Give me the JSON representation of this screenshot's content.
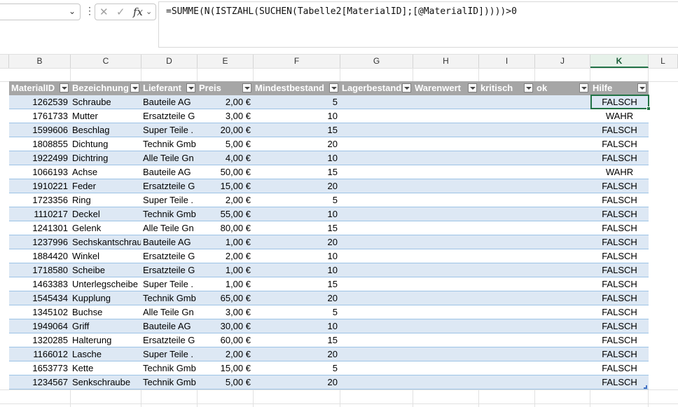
{
  "formula_bar": {
    "formula": "=SUMME(N(ISTZAHL(SUCHEN(Tabelle2[MaterialID];[@MaterialID]))))>0",
    "fx_label": "fx",
    "cancel_glyph": "✕",
    "enter_glyph": "✓"
  },
  "columns": [
    "B",
    "C",
    "D",
    "E",
    "F",
    "G",
    "H",
    "I",
    "J",
    "K",
    "L"
  ],
  "selected_column": "K",
  "table_headers": [
    "MaterialID",
    "Bezeichnung",
    "Lieferant",
    "Preis",
    "Mindestbestand",
    "Lagerbestand",
    "Warenwert",
    "kritisch",
    "ok",
    "Hilfe"
  ],
  "rows": [
    {
      "id": "1262539",
      "name": "Schraube",
      "supplier": "Bauteile AG",
      "price": "2,00 €",
      "min": "5",
      "help": "FALSCH"
    },
    {
      "id": "1761733",
      "name": "Mutter",
      "supplier": "Ersatzteile G",
      "price": "3,00 €",
      "min": "10",
      "help": "WAHR"
    },
    {
      "id": "1599606",
      "name": "Beschlag",
      "supplier": "Super Teile .",
      "price": "20,00 €",
      "min": "15",
      "help": "FALSCH"
    },
    {
      "id": "1808855",
      "name": "Dichtung",
      "supplier": "Technik Gmb",
      "price": "5,00 €",
      "min": "20",
      "help": "FALSCH"
    },
    {
      "id": "1922499",
      "name": "Dichtring",
      "supplier": "Alle Teile Gn",
      "price": "4,00 €",
      "min": "10",
      "help": "FALSCH"
    },
    {
      "id": "1066193",
      "name": "Achse",
      "supplier": "Bauteile AG",
      "price": "50,00 €",
      "min": "15",
      "help": "WAHR"
    },
    {
      "id": "1910221",
      "name": "Feder",
      "supplier": "Ersatzteile G",
      "price": "15,00 €",
      "min": "20",
      "help": "FALSCH"
    },
    {
      "id": "1723356",
      "name": "Ring",
      "supplier": "Super Teile .",
      "price": "2,00 €",
      "min": "5",
      "help": "FALSCH"
    },
    {
      "id": "1110217",
      "name": "Deckel",
      "supplier": "Technik Gmb",
      "price": "55,00 €",
      "min": "10",
      "help": "FALSCH"
    },
    {
      "id": "1241301",
      "name": "Gelenk",
      "supplier": "Alle Teile Gn",
      "price": "80,00 €",
      "min": "15",
      "help": "FALSCH"
    },
    {
      "id": "1237996",
      "name": "Sechskantschrau",
      "supplier": "Bauteile AG",
      "price": "1,00 €",
      "min": "20",
      "help": "FALSCH"
    },
    {
      "id": "1884420",
      "name": "Winkel",
      "supplier": "Ersatzteile G",
      "price": "2,00 €",
      "min": "10",
      "help": "FALSCH"
    },
    {
      "id": "1718580",
      "name": "Scheibe",
      "supplier": "Ersatzteile G",
      "price": "1,00 €",
      "min": "10",
      "help": "FALSCH"
    },
    {
      "id": "1463383",
      "name": "Unterlegscheibe",
      "supplier": "Super Teile .",
      "price": "1,00 €",
      "min": "15",
      "help": "FALSCH"
    },
    {
      "id": "1545434",
      "name": "Kupplung",
      "supplier": "Technik Gmb",
      "price": "65,00 €",
      "min": "20",
      "help": "FALSCH"
    },
    {
      "id": "1345102",
      "name": "Buchse",
      "supplier": "Alle Teile Gn",
      "price": "3,00 €",
      "min": "5",
      "help": "FALSCH"
    },
    {
      "id": "1949064",
      "name": "Griff",
      "supplier": "Bauteile AG",
      "price": "30,00 €",
      "min": "10",
      "help": "FALSCH"
    },
    {
      "id": "1320285",
      "name": "Halterung",
      "supplier": "Ersatzteile G",
      "price": "60,00 €",
      "min": "15",
      "help": "FALSCH"
    },
    {
      "id": "1166012",
      "name": "Lasche",
      "supplier": "Super Teile .",
      "price": "2,00 €",
      "min": "20",
      "help": "FALSCH"
    },
    {
      "id": "1653773",
      "name": "Kette",
      "supplier": "Technik Gmb",
      "price": "15,00 €",
      "min": "5",
      "help": "FALSCH"
    },
    {
      "id": "1234567",
      "name": "Senkschraube",
      "supplier": "Technik Gmb",
      "price": "5,00 €",
      "min": "20",
      "help": "FALSCH"
    }
  ],
  "colors": {
    "header_fill": "#a6a6a6",
    "band_fill": "#dde8f4",
    "selection": "#217346"
  }
}
